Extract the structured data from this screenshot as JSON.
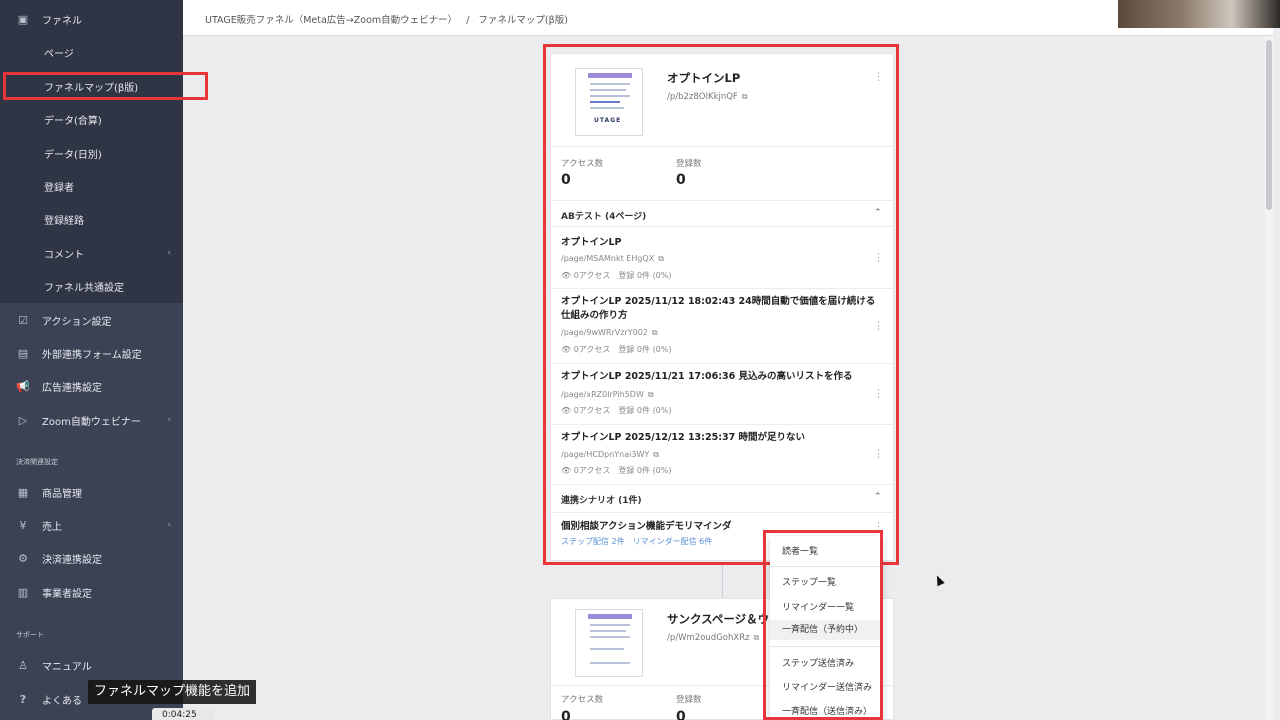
{
  "breadcrumb": {
    "funnel": "UTAGE販売ファネル（Meta広告→Zoom自動ウェビナー）",
    "sep": "/",
    "current": "ファネルマップ(β版)"
  },
  "sidebar": {
    "funnel_header": "ファネル",
    "sub_items": [
      "ページ",
      "ファネルマップ(β版)",
      "データ(合算)",
      "データ(日別)",
      "登録者",
      "登録経路",
      "コメント",
      "ファネル共通設定"
    ],
    "items": [
      "アクション設定",
      "外部連携フォーム設定",
      "広告連携設定",
      "Zoom自動ウェビナー"
    ],
    "section_payment": "決済関連設定",
    "payment_items": [
      "商品管理",
      "売上",
      "決済連携設定",
      "事業者設定"
    ],
    "section_support": "サポート",
    "support_items": [
      "マニュアル",
      "よくある"
    ]
  },
  "card1": {
    "title": "オプトインLP",
    "path": "/p/b2z8OIKkjnQF",
    "stat1_label": "アクセス数",
    "stat1_value": "0",
    "stat2_label": "登録数",
    "stat2_value": "0",
    "thumb_logo": "UTAGE",
    "ab_header": "ABテスト (4ページ)",
    "variants": [
      {
        "title": "オプトインLP",
        "path": "/page/MSAMnkt EHgQX",
        "stats": "👁 0アクセス　登録 0件 (0%)"
      },
      {
        "title": "オプトインLP 2025/11/12 18:02:43 24時間自動で価値を届け続ける仕組みの作り方",
        "path": "/page/9wWRrVzrY002",
        "stats": "👁 0アクセス　登録 0件 (0%)"
      },
      {
        "title": "オプトインLP 2025/11/21 17:06:36 見込みの高いリストを作る",
        "path": "/page/xRZ0lrPih5DW",
        "stats": "👁 0アクセス　登録 0件 (0%)"
      },
      {
        "title": "オプトインLP 2025/12/12 13:25:37 時間が足りない",
        "path": "/page/HCDpnYnai3WY",
        "stats": "👁 0アクセス　登録 0件 (0%)"
      }
    ],
    "scenario_header": "連携シナリオ (1件)",
    "scenario_title": "個別相談アクション機能デモリマインダ",
    "scenario_links": "ステップ配信 2件　リマインダー配信 6件"
  },
  "card2": {
    "title": "サンクスページ＆ウ",
    "path": "/p/Wm2oudGohXRz",
    "stat1_label": "アクセス数",
    "stat2_label": "登録数",
    "stat1_value": "0",
    "stat2_value": "0"
  },
  "menu": {
    "items": [
      "読者一覧",
      "ステップ一覧",
      "リマインダー一覧",
      "一斉配信（予約中）",
      "ステップ送信済み",
      "リマインダー送信済み",
      "一斉配信（送信済み）"
    ]
  },
  "overlay": {
    "caption": "ファネルマップ機能を追加",
    "timecode": "0:04:25"
  }
}
